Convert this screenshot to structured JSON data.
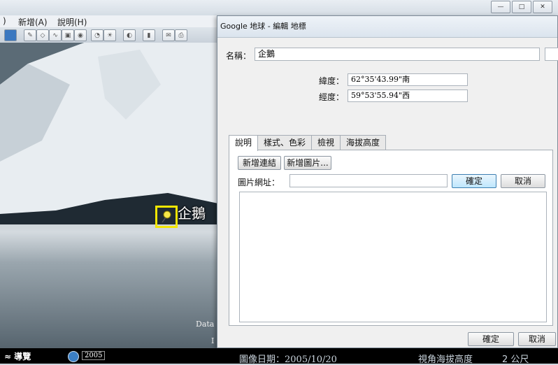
{
  "window": {
    "min_label": "—",
    "max_label": "□",
    "close_label": "✕"
  },
  "menu": {
    "partial": ")",
    "add": "新增(A)",
    "help": "說明(H)"
  },
  "earth": {
    "placemark_label": "企鵝",
    "credit_data": "Data",
    "credit_line2": "I"
  },
  "status": {
    "nav": "≈ 導覽",
    "year": "2005",
    "image_date": "圖像日期：2005/10/20",
    "view_altitude": "視角海拔高度",
    "distance": "2 公尺"
  },
  "dialog": {
    "title": "Google 地球 - 編輯 地標",
    "name_label": "名稱：",
    "name_value": "企鵝",
    "lat_label": "緯度：",
    "lat_value": "62°35'43.99\"南",
    "lon_label": "經度：",
    "lon_value": "59°53'55.94\"西",
    "tabs": [
      "說明",
      "樣式、色彩",
      "檢視",
      "海拔高度"
    ],
    "add_link": "新增連結",
    "add_image": "新增圖片...",
    "image_url_label": "圖片網址：",
    "url_ok": "確定",
    "url_cancel": "取消",
    "ok": "確定",
    "cancel": "取消"
  },
  "colors": {
    "placemark_highlight": "#f2e600",
    "pin": "#f7e84a"
  }
}
